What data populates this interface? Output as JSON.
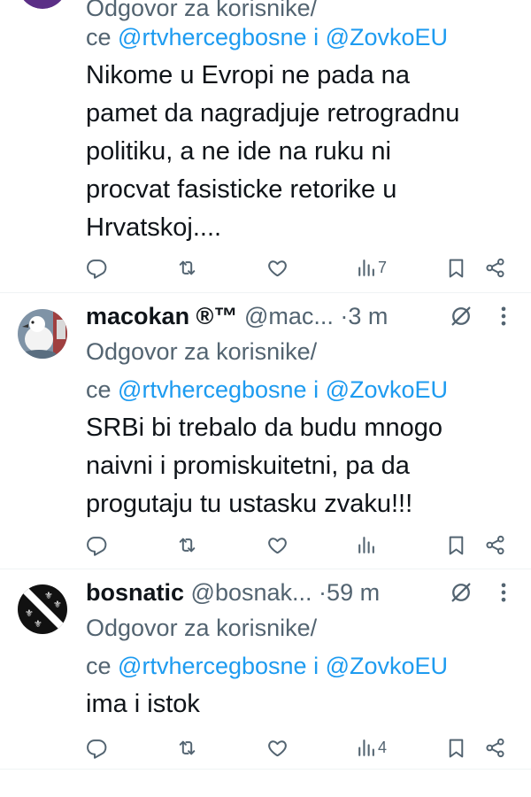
{
  "tweets": [
    {
      "reply_label_1": "Odgovor za korisnike/",
      "reply_label_2": "ce",
      "mention_1": "@rtvhercegbosne",
      "conj": "i",
      "mention_2": "@ZovkoEU",
      "text_lines": [
        "Nikome u Evropi ne pada na",
        "pamet da nagradjuje retrogradnu",
        "politiku, a ne ide na ruku ni",
        "procvat fasisticke retorike u",
        "Hrvatskoj...."
      ],
      "views": "7"
    },
    {
      "name": "macokan ®™",
      "handle": "@mac...",
      "sep": "·",
      "time": "3 m",
      "reply_label_1": "Odgovor za korisnike/",
      "reply_label_2": "ce",
      "mention_1": "@rtvhercegbosne",
      "conj": "i",
      "mention_2": "@ZovkoEU",
      "text_lines": [
        "SRBi bi trebalo da budu mnogo",
        "naivni i promiskuitetni, pa da",
        "progutaju tu ustasku zvaku!!!"
      ],
      "views": ""
    },
    {
      "name": "bosnatic",
      "handle": "@bosnak...",
      "sep": "·",
      "time": "59 m",
      "reply_label_1": "Odgovor za korisnike/",
      "reply_label_2": "ce",
      "mention_1": "@rtvhercegbosne",
      "conj": "i",
      "mention_2": "@ZovkoEU",
      "text_lines": [
        "ima i istok"
      ],
      "views": "4"
    }
  ],
  "icons": {
    "reply": "speech-bubble-icon",
    "retweet": "retweet-arrows-icon",
    "like": "heart-outline-icon",
    "views": "bar-chart-icon",
    "bookmark": "bookmark-icon",
    "share": "share-nodes-icon",
    "grok": "slashed-circle-icon",
    "more": "vertical-dots-icon"
  },
  "colors": {
    "text": "#0f1419",
    "secondary": "#536471",
    "link": "#1d9bf0",
    "divider": "#eff3f4",
    "avatar_1": "#5b2f86"
  }
}
